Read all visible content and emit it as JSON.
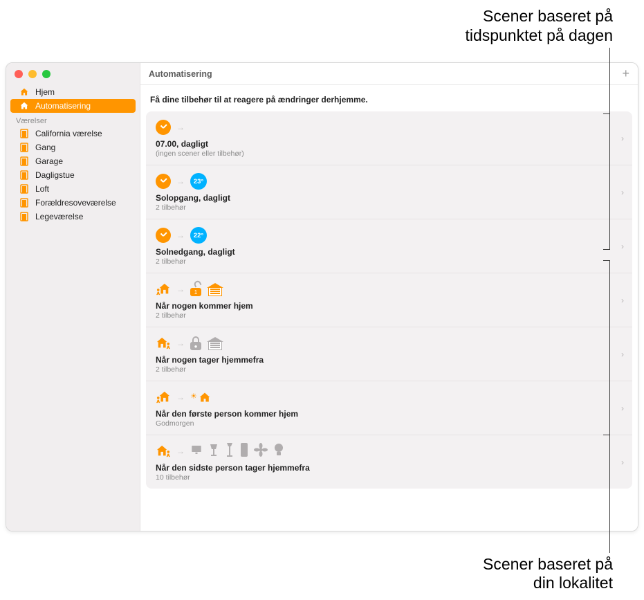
{
  "callouts": {
    "top_line1": "Scener baseret på",
    "top_line2": "tidspunktet på dagen",
    "bottom_line1": "Scener baseret på",
    "bottom_line2": "din lokalitet"
  },
  "sidebar": {
    "home_label": "Hjem",
    "automation_label": "Automatisering",
    "rooms_heading": "Værelser",
    "rooms": [
      {
        "label": "California værelse"
      },
      {
        "label": "Gang"
      },
      {
        "label": "Garage"
      },
      {
        "label": "Dagligstue"
      },
      {
        "label": "Loft"
      },
      {
        "label": "Forældresoveværelse"
      },
      {
        "label": "Legeværelse"
      }
    ]
  },
  "content": {
    "title": "Automatisering",
    "add_glyph": "+",
    "subtitle": "Få dine tilbehør til at reagere på ændringer derhjemme.",
    "rows": [
      {
        "title": "07.00, dagligt",
        "sub": "(ingen scener eller tilbehør)",
        "badge": ""
      },
      {
        "title": "Solopgang, dagligt",
        "sub": "2 tilbehør",
        "badge": "23°"
      },
      {
        "title": "Solnedgang, dagligt",
        "sub": "2 tilbehør",
        "badge": "22°"
      },
      {
        "title": "Når nogen kommer hjem",
        "sub": "2 tilbehør"
      },
      {
        "title": "Når nogen tager hjemmefra",
        "sub": "2 tilbehør"
      },
      {
        "title": "Når den første person kommer hjem",
        "sub": "Godmorgen"
      },
      {
        "title": "Når den sidste person tager hjemmefra",
        "sub": "10 tilbehør"
      }
    ]
  }
}
